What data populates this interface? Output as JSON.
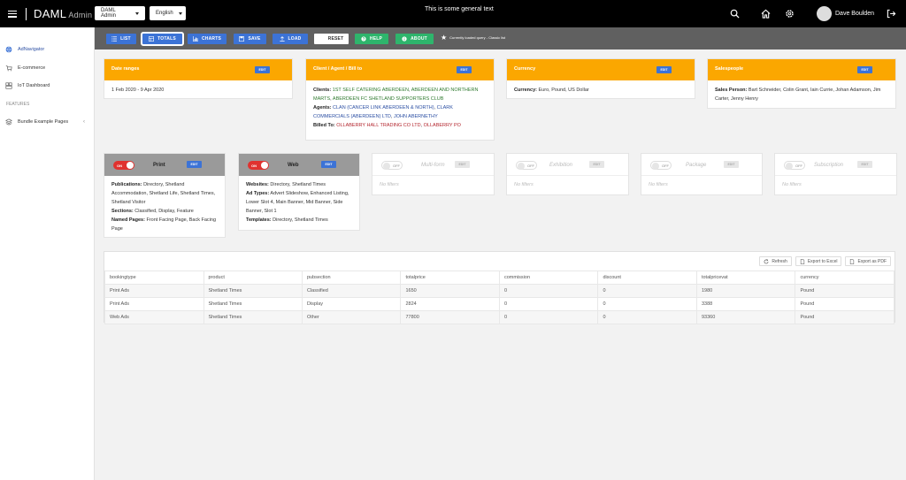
{
  "header": {
    "brand": "DAML",
    "brand_sub": "Admin",
    "org_select": "DAML Admin",
    "lang_select": "English",
    "general_text": "This is some general text",
    "user_name": "Dave Boulden"
  },
  "sidebar": {
    "items": [
      {
        "label": "AdNavigator"
      },
      {
        "label": "E-commerce"
      },
      {
        "label": "IoT Dashboard"
      }
    ],
    "section": "FEATURES",
    "bundle": {
      "label": "Bundle Example Pages",
      "chevron": "‹"
    }
  },
  "toolbar": {
    "list": "LIST",
    "totals": "TOTALS",
    "charts": "CHARTS",
    "save": "SAVE",
    "load": "LOAD",
    "reset": "RESET",
    "help": "HELP",
    "about": "ABOUT",
    "note": "Currently loaded query - Classic list"
  },
  "filters": {
    "edit_label": "EDIT",
    "date": {
      "title": "Date ranges",
      "value": "1 Feb 2020 - 9 Apr 2020"
    },
    "client": {
      "title": "Client / Agent / Bill to",
      "clients_label": "Clients:",
      "clients": [
        "1ST SELF CATERING ABERDEEN",
        "ABERDEEN AND NORTHERN MARTS",
        "ABERDEEN FC SHETLAND SUPPORTERS CLUB"
      ],
      "agents_label": "Agents:",
      "agents": [
        "CLAN (CANCER LINK ABERDEEN & NORTH)",
        "CLARK COMMERCIALS (ABERDEEN) LTD",
        "JOHN ABERNETHY"
      ],
      "billed_label": "Billed To:",
      "billed": [
        "OLLABERRY HALL TRADING CO LTD",
        "OLLABERRY PO"
      ]
    },
    "currency": {
      "title": "Currency",
      "label": "Currency:",
      "values": [
        "Euro",
        "Pound",
        "US Dollar"
      ]
    },
    "salespeople": {
      "title": "Salespeople",
      "label": "Sales Person:",
      "values": [
        "Bart Schneider",
        "Colin Grant",
        "Iain Currie",
        "Johan Adamson",
        "Jim Carter",
        "Jenny Henry"
      ]
    }
  },
  "products": {
    "on_label": "ON",
    "off_label": "OFF",
    "no_filters": "No filters",
    "print": {
      "title": "Print",
      "pub_label": "Publications:",
      "publications": [
        "Directory",
        "Shetland Accommodation",
        "Shetland Life",
        "Shetland Times",
        "Shetland Visitor"
      ],
      "sec_label": "Sections:",
      "sections": [
        "Classified",
        "Display",
        "Feature"
      ],
      "pages_label": "Named Pages:",
      "pages": [
        "Front Facing Page",
        "Back Facing Page"
      ]
    },
    "web": {
      "title": "Web",
      "sites_label": "Websites:",
      "sites": [
        "Directory",
        "Shetland Times"
      ],
      "ad_label": "Ad Types:",
      "ad_types": [
        "Advert Slideshow",
        "Enhanced Listing",
        "Lower Slot 4",
        "Main Banner",
        "Mid Banner",
        "Side Banner",
        "Slot 1"
      ],
      "tpl_label": "Templates:",
      "templates": [
        "Directory",
        "Shetland Times"
      ]
    },
    "multiform": {
      "title": "Multi-form"
    },
    "exhibition": {
      "title": "Exhibition"
    },
    "package": {
      "title": "Package"
    },
    "subscription": {
      "title": "Subscription"
    }
  },
  "table": {
    "refresh": "Refresh",
    "export_excel": "Export to Excel",
    "export_pdf": "Export as PDF",
    "columns": [
      "bookingtype",
      "product",
      "pubsection",
      "totalprice",
      "commission",
      "discount",
      "totalpricevat",
      "currency"
    ],
    "rows": [
      [
        "Print Ads",
        "Shetland Times",
        "Classified",
        "1650",
        "0",
        "0",
        "1980",
        "Pound"
      ],
      [
        "Print Ads",
        "Shetland Times",
        "Display",
        "2824",
        "0",
        "0",
        "3388",
        "Pound"
      ],
      [
        "Web Ads",
        "Shetland Times",
        "Other",
        "77800",
        "0",
        "0",
        "93360",
        "Pound"
      ]
    ]
  },
  "colors": {
    "accent_orange": "#fba700",
    "accent_blue": "#3c73d6",
    "accent_green": "#2eb56c",
    "toggle_on": "#e0322f"
  }
}
